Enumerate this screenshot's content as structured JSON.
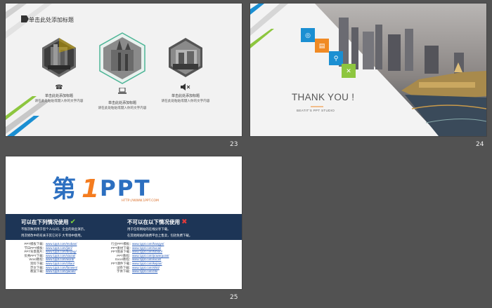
{
  "slides": [
    {
      "number": "23",
      "title": "单击此处添加标题",
      "items": [
        {
          "heading": "单击此处添加标题",
          "body": "请在此处粘贴或键入你的文字内容",
          "icon": "phone-icon"
        },
        {
          "heading": "单击此处添加标题",
          "body": "请在此处粘贴或键入你的文字内容",
          "icon": "laptop-icon"
        },
        {
          "heading": "单击此处添加标题",
          "body": "请在此处粘贴或键入你的文字内容",
          "icon": "speaker-icon"
        }
      ]
    },
    {
      "number": "24",
      "thanks": "THANK YOU !",
      "studio": "BEATIT'S  PPT STUDIO",
      "tiles": [
        {
          "icon": "lightbulb-icon",
          "color": "#1b8fd2"
        },
        {
          "icon": "document-icon",
          "color": "#f08a24"
        },
        {
          "icon": "search-icon",
          "color": "#1b8fd2"
        },
        {
          "icon": "tools-icon",
          "color": "#8dc63f"
        }
      ]
    },
    {
      "number": "25",
      "logo_text": "第1PPT",
      "logo_url": "HTTP://WWW.1PPT.COM",
      "allowed_title": "可以在下列情况使用",
      "forbidden_title": "不可以在以下情况使用",
      "allowed_notes": [
        "不限次数的用于您个人/公司、企业的商业演示。",
        "用次修改中的有关于其它对于 大专场中使用。"
      ],
      "forbidden_notes": [
        "用于任何网站的在线分享下载。",
        "在其他网站的收费平台上售卖，包括免费下载。"
      ],
      "links_left": [
        {
          "label": "PPT模板下载：",
          "url": "www.1ppt.com/moban/"
        },
        {
          "label": "节日PPT模板：",
          "url": "www.1ppt.com/jieri/"
        },
        {
          "label": "PPT背景图片：",
          "url": "www.1ppt.com/beijing/"
        },
        {
          "label": "优秀PPT下载：",
          "url": "www.1ppt.com/xiazai/"
        },
        {
          "label": "Word教程：",
          "url": "www.1ppt.com/word/"
        },
        {
          "label": "资料下载：",
          "url": "www.1ppt.com/ziliao/"
        },
        {
          "label": "范文下载：",
          "url": "www.1ppt.com/fanwen/"
        },
        {
          "label": "教案下载：",
          "url": "www.1ppt.com/jiaoan/"
        }
      ],
      "links_right": [
        {
          "label": "行业PPT模板：",
          "url": "www.1ppt.com/hangye/"
        },
        {
          "label": "PPT素材下载：",
          "url": "www.1ppt.com/sucai/"
        },
        {
          "label": "PPT图表下载：",
          "url": "www.1ppt.com/tubiao/"
        },
        {
          "label": "PPT教程：",
          "url": "www.1ppt.com/powerpoint/"
        },
        {
          "label": "Excel教程：",
          "url": "www.1ppt.com/excel/"
        },
        {
          "label": "PPT课件下载：",
          "url": "www.1ppt.com/kejian/"
        },
        {
          "label": "试卷下载：",
          "url": "www.1ppt.com/shiti/"
        },
        {
          "label": "字体下载：",
          "url": "www.1ppt.com/ziti/"
        }
      ]
    }
  ]
}
